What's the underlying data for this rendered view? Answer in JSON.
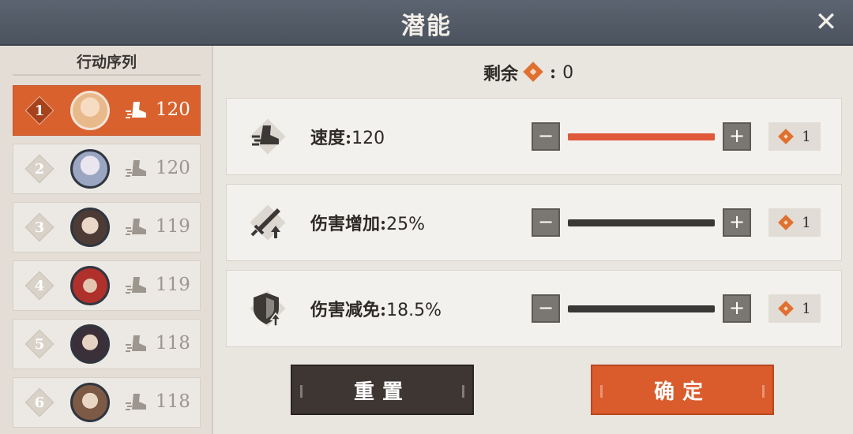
{
  "header": {
    "title": "潜能",
    "close_icon": "close-icon"
  },
  "sidebar": {
    "title": "行动序列",
    "items": [
      {
        "index": "1",
        "speed": "120",
        "active": true,
        "avatar_color": "#e8b98a"
      },
      {
        "index": "2",
        "speed": "120",
        "active": false,
        "avatar_color": "#b9c3d6"
      },
      {
        "index": "3",
        "speed": "119",
        "active": false,
        "avatar_color": "#6f5a52"
      },
      {
        "index": "4",
        "speed": "119",
        "active": false,
        "avatar_color": "#b0302c"
      },
      {
        "index": "5",
        "speed": "118",
        "active": false,
        "avatar_color": "#4a3f48"
      },
      {
        "index": "6",
        "speed": "118",
        "active": false,
        "avatar_color": "#8c6a52"
      }
    ]
  },
  "remaining": {
    "label": "剩余",
    "separator": ":",
    "value": "0"
  },
  "stats": [
    {
      "name": "速度",
      "separator": ":",
      "value": "120",
      "icon": "speed-boot-icon",
      "level": 1.0,
      "cost": "1"
    },
    {
      "name": "伤害增加",
      "separator": ":",
      "value": "25%",
      "icon": "sword-up-icon",
      "level": 0.0,
      "cost": "1"
    },
    {
      "name": "伤害减免",
      "separator": ":",
      "value": "18.5%",
      "icon": "shield-up-icon",
      "level": 0.0,
      "cost": "1"
    }
  ],
  "buttons": {
    "minus": "−",
    "plus": "+",
    "reset": "重置",
    "confirm": "确定"
  },
  "colors": {
    "accent": "#da5b2b",
    "header": "#525a66",
    "gem": "#e0702f",
    "bar_fill": "#e0593a"
  }
}
